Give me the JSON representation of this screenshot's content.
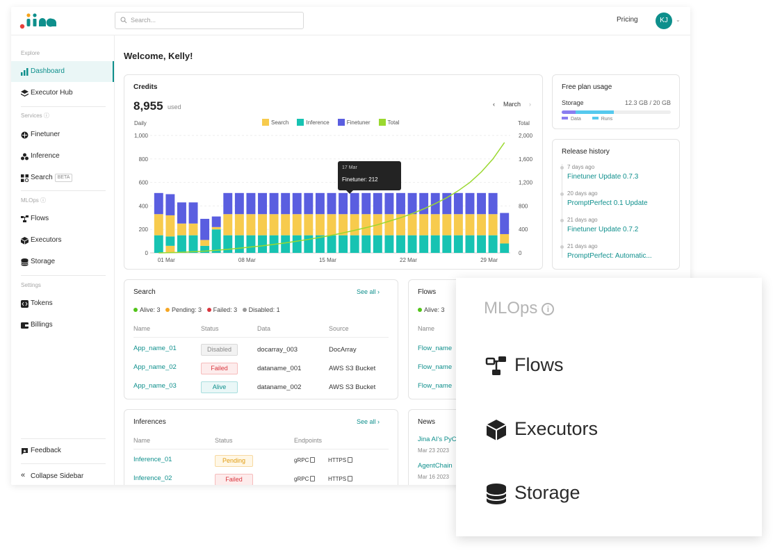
{
  "brand": {
    "logo_text": "jina"
  },
  "search": {
    "placeholder": "Search..."
  },
  "header": {
    "pricing": "Pricing",
    "avatar_initials": "KJ"
  },
  "sidebar": {
    "sections": {
      "explore": "Explore",
      "services": "Services",
      "mlops": "MLOps",
      "settings": "Settings"
    },
    "items": {
      "dashboard": "Dashboard",
      "executor_hub": "Executor Hub",
      "finetuner": "Finetuner",
      "inference": "Inference",
      "search": "Search",
      "search_badge": "BETA",
      "flows": "Flows",
      "executors": "Executors",
      "storage": "Storage",
      "tokens": "Tokens",
      "billings": "Billings",
      "feedback": "Feedback",
      "collapse": "Collapse Sidebar"
    }
  },
  "welcome": "Welcome, Kelly!",
  "credits": {
    "title": "Credits",
    "value": "8,955",
    "unit": "used",
    "month": "March",
    "left_axis_label": "Daily",
    "right_axis_label": "Total",
    "tooltip_date": "17 Mar",
    "tooltip_value": "Finetuner: 212"
  },
  "chart_data": {
    "type": "bar",
    "title": "Credits",
    "ylabel": "Daily",
    "y2label": "Total",
    "ylim": [
      0,
      1000
    ],
    "y2lim": [
      0,
      2000
    ],
    "yticks": [
      "0",
      "200",
      "400",
      "600",
      "800",
      "1,000"
    ],
    "y2ticks": [
      "0",
      "400",
      "800",
      "1,200",
      "1,600",
      "2,000"
    ],
    "xticks": [
      "01 Mar",
      "08 Mar",
      "15 Mar",
      "22 Mar",
      "29 Mar"
    ],
    "stacked": true,
    "categories": [
      "01",
      "02",
      "03",
      "04",
      "05",
      "06",
      "07",
      "08",
      "09",
      "10",
      "11",
      "12",
      "13",
      "14",
      "15",
      "16",
      "17",
      "18",
      "19",
      "20",
      "21",
      "22",
      "23",
      "24",
      "25",
      "26",
      "27",
      "28",
      "29",
      "30",
      "31"
    ],
    "series": [
      {
        "name": "Search",
        "color": "#f7cb4d",
        "values": [
          0,
          60,
          0,
          0,
          0,
          0,
          0,
          0,
          0,
          0,
          0,
          0,
          0,
          0,
          0,
          0,
          0,
          0,
          0,
          0,
          0,
          0,
          0,
          0,
          0,
          0,
          0,
          0,
          0,
          0,
          0
        ]
      },
      {
        "name": "Inference",
        "color": "#17c3b2",
        "values": [
          150,
          80,
          150,
          150,
          60,
          200,
          150,
          150,
          150,
          150,
          150,
          150,
          150,
          150,
          150,
          150,
          150,
          150,
          150,
          150,
          150,
          150,
          150,
          150,
          150,
          150,
          150,
          150,
          150,
          150,
          80
        ]
      },
      {
        "name": "Search",
        "color": "#f7cb4d",
        "values": [
          180,
          180,
          100,
          100,
          50,
          20,
          180,
          180,
          180,
          180,
          180,
          180,
          180,
          180,
          180,
          180,
          180,
          180,
          180,
          180,
          180,
          180,
          180,
          180,
          180,
          180,
          180,
          180,
          180,
          180,
          80
        ]
      },
      {
        "name": "Finetuner",
        "color": "#5a5ee0",
        "values": [
          180,
          180,
          180,
          180,
          180,
          90,
          180,
          180,
          180,
          180,
          180,
          180,
          180,
          180,
          180,
          180,
          180,
          180,
          180,
          180,
          180,
          180,
          180,
          180,
          180,
          180,
          180,
          180,
          180,
          180,
          180
        ]
      }
    ],
    "total_line": {
      "name": "Total",
      "color": "#9ad82f",
      "values": [
        0,
        5,
        10,
        20,
        30,
        45,
        60,
        80,
        100,
        120,
        145,
        170,
        200,
        230,
        265,
        300,
        340,
        385,
        430,
        480,
        540,
        600,
        670,
        750,
        840,
        940,
        1060,
        1200,
        1380,
        1600,
        1880
      ]
    },
    "legend": [
      "Search",
      "Inference",
      "Finetuner",
      "Total"
    ],
    "legend_colors": [
      "#f7cb4d",
      "#17c3b2",
      "#5a5ee0",
      "#9ad82f"
    ]
  },
  "free_plan": {
    "title": "Free plan usage",
    "storage_label": "Storage",
    "storage_value": "12.3 GB / 20 GB",
    "data_fraction": 0.13,
    "runs_fraction": 0.48,
    "legend_data": "Data",
    "legend_runs": "Runs"
  },
  "release_history": {
    "title": "Release history",
    "items": [
      {
        "time": "7 days ago",
        "name": "Finetuner Update 0.7.3"
      },
      {
        "time": "20 days ago",
        "name": "PromptPerfect 0.1 Update"
      },
      {
        "time": "21 days ago",
        "name": "Finetuner Update 0.7.2"
      },
      {
        "time": "21 days ago",
        "name": "PromptPerfect: Automatic..."
      }
    ]
  },
  "search_card": {
    "title": "Search",
    "see_all": "See all",
    "status": {
      "alive": "Alive: 3",
      "pending": "Pending: 3",
      "failed": "Failed: 3",
      "disabled": "Disabled: 1"
    },
    "columns": [
      "Name",
      "Status",
      "Data",
      "Source"
    ],
    "rows": [
      {
        "name": "App_name_01",
        "status": "Disabled",
        "data": "docarray_003",
        "source": "DocArray"
      },
      {
        "name": "App_name_02",
        "status": "Failed",
        "data": "dataname_001",
        "source": "AWS S3 Bucket"
      },
      {
        "name": "App_name_03",
        "status": "Alive",
        "data": "dataname_002",
        "source": "AWS S3 Bucket"
      }
    ]
  },
  "flows_card": {
    "title": "Flows",
    "status_alive": "Alive: 3",
    "column_name": "Name",
    "rows": [
      "Flow_name",
      "Flow_name",
      "Flow_name"
    ]
  },
  "inferences_card": {
    "title": "Inferences",
    "see_all": "See all",
    "columns": [
      "Name",
      "Status",
      "Endpoints"
    ],
    "rows": [
      {
        "name": "Inference_01",
        "status": "Pending",
        "ep1": "gRPC",
        "ep2": "HTTPS"
      },
      {
        "name": "Inference_02",
        "status": "Failed",
        "ep1": "gRPC",
        "ep2": "HTTPS"
      }
    ]
  },
  "news_card": {
    "title": "News",
    "items": [
      {
        "title": "Jina AI's PyC",
        "date": "Mar 23 2023"
      },
      {
        "title": "AgentChain",
        "date": "Mar 16 2023"
      }
    ]
  },
  "zoom": {
    "section": "MLOps",
    "info": "i",
    "items": [
      "Flows",
      "Executors",
      "Storage"
    ]
  }
}
